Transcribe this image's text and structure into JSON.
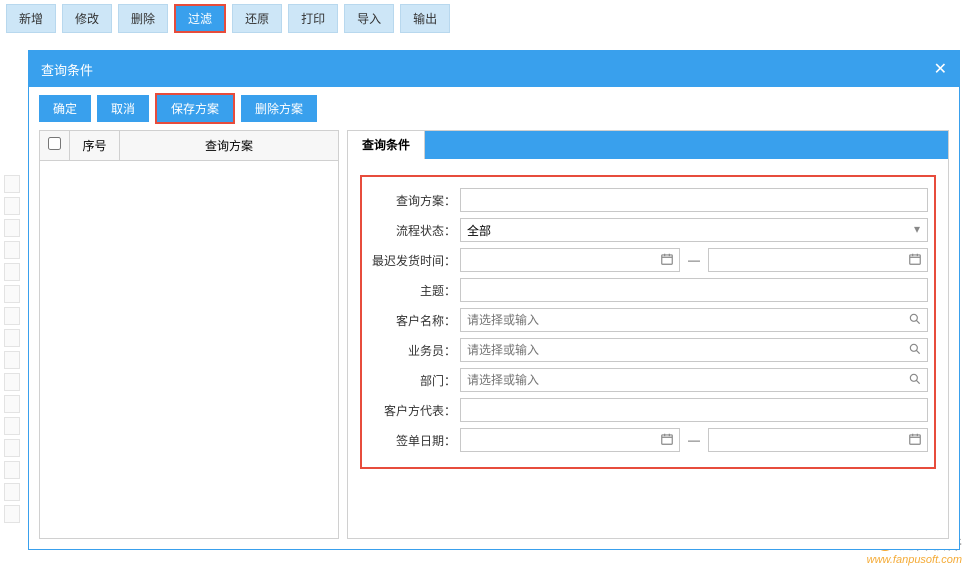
{
  "toolbar": {
    "add": "新增",
    "edit": "修改",
    "delete": "删除",
    "filter": "过滤",
    "restore": "还原",
    "print": "打印",
    "import": "导入",
    "export": "输出"
  },
  "modal": {
    "title": "查询条件",
    "close": "✕",
    "buttons": {
      "ok": "确定",
      "cancel": "取消",
      "save_scheme": "保存方案",
      "delete_scheme": "删除方案"
    },
    "left_table": {
      "col_no": "序号",
      "col_scheme": "查询方案"
    },
    "tab_label": "查询条件",
    "form": {
      "scheme_label": "查询方案：",
      "scheme_value": "",
      "status_label": "流程状态：",
      "status_value": "全部",
      "latest_ship_label": "最迟发货时间：",
      "latest_ship_from": "",
      "latest_ship_to": "",
      "subject_label": "主题：",
      "subject_value": "",
      "customer_label": "客户名称：",
      "customer_placeholder": "请选择或输入",
      "salesman_label": "业务员：",
      "salesman_placeholder": "请选择或输入",
      "dept_label": "部门：",
      "dept_placeholder": "请选择或输入",
      "cust_rep_label": "客户方代表：",
      "cust_rep_value": "",
      "sign_date_label": "签单日期：",
      "sign_date_from": "",
      "sign_date_to": "",
      "range_dash": "—"
    }
  },
  "watermark": {
    "brand": "泛普软件",
    "url": "www.fanpusoft.com"
  }
}
